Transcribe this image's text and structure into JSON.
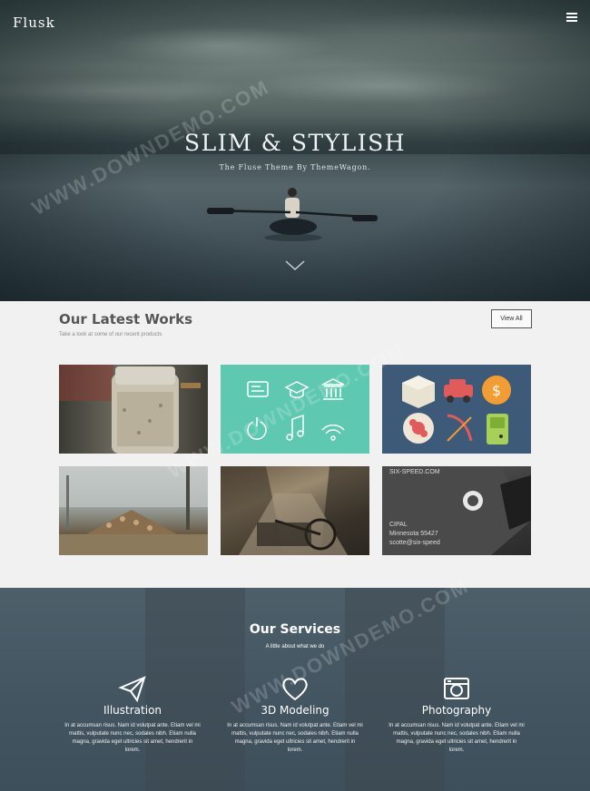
{
  "header": {
    "logo": "Flusk",
    "menu_icon": "hamburger-menu-icon"
  },
  "hero": {
    "title": "SLIM & STYLISH",
    "subtitle": "The Fluse Theme By ThemeWagon.",
    "scroll_icon": "chevron-down-icon"
  },
  "works": {
    "title": "Our Latest Works",
    "subtitle": "Take a look at some of our recent products",
    "view_all_label": "View All",
    "tiles": [
      {
        "name": "jar-photo"
      },
      {
        "name": "line-icons-graphic"
      },
      {
        "name": "flat-icons-graphic"
      },
      {
        "name": "logs-photo"
      },
      {
        "name": "street-bike-photo"
      },
      {
        "name": "business-card-photo",
        "card_text": [
          "SIX-SPEED.COM",
          "CIPAL",
          "Minnesota 55427",
          "scotte@six-speed"
        ]
      }
    ]
  },
  "services": {
    "title": "Our Services",
    "subtitle": "A little about what we do",
    "items": [
      {
        "icon": "paper-plane-icon",
        "name": "Illustration",
        "desc": "In at accumsan risus. Nam id volutpat ante. Etiam vel mi mattis, vulputate nunc nec, sodales nibh. Etiam nulla magna, gravida eget ultricies sit amet, hendrerit in lorem."
      },
      {
        "icon": "heart-icon",
        "name": "3D Modeling",
        "desc": "In at accumsan risus. Nam id volutpat ante. Etiam vel mi mattis, vulputate nunc nec, sodales nibh. Etiam nulla magna, gravida eget ultricies sit amet, hendrerit in lorem."
      },
      {
        "icon": "camera-icon",
        "name": "Photography",
        "desc": "In at accumsan risus. Nam id volutpat ante. Etiam vel mi mattis, vulputate nunc nec, sodales nibh. Etiam nulla magna, gravida eget ultricies sit amet, hendrerit in lorem."
      }
    ]
  },
  "watermark": {
    "text": "WWW.DOWNDEMO.COM"
  },
  "colors": {
    "teal_tile": "#5ec9b0",
    "navy_tile": "#3d5a78",
    "section_bg": "#f1f1f1",
    "services_bg": "#435561"
  }
}
